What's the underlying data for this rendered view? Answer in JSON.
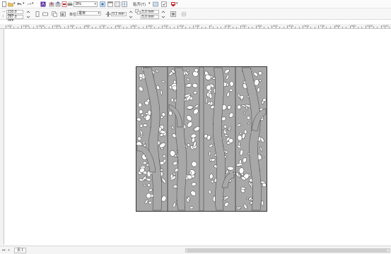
{
  "toolbar": {
    "zoom_value": "8%",
    "snap_label": "贴齐(T)"
  },
  "property_bar": {
    "width_value": "210.0 mm",
    "height_value": "297.0 mm",
    "units_label": "单位:",
    "units_value": "毫米",
    "nudge_value": "0.1 mm",
    "dup_x_value": "5.0 mm",
    "dup_y_value": "5.0 mm"
  },
  "ruler": {
    "labels": [
      "100",
      "1200",
      "1100",
      "1000",
      "900",
      "800",
      "700",
      "600",
      "500",
      "400",
      "300",
      "200",
      "100",
      "0",
      "100",
      "200",
      "300",
      "400",
      "500",
      "600",
      "700",
      "800",
      "900",
      "1000",
      "1100"
    ]
  },
  "status": {
    "page_tab_label": "页 1"
  },
  "colors": {
    "panel_fill": "#a8a8a8",
    "panel_stroke": "#333333",
    "accent": "#6a2fb0"
  }
}
